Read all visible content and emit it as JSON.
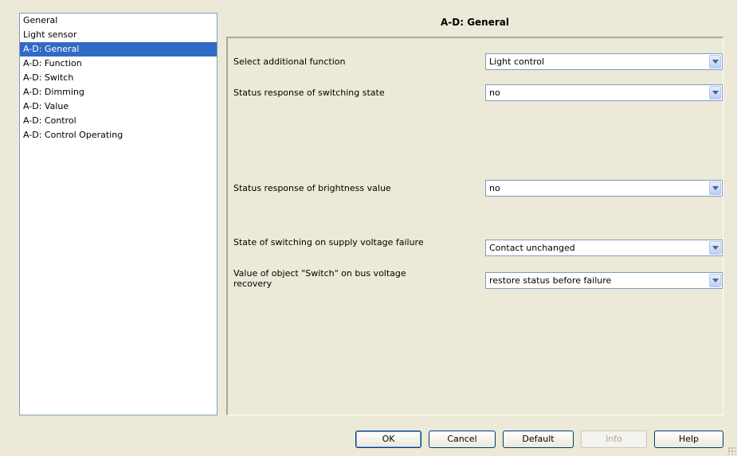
{
  "nav": {
    "items": [
      {
        "label": "General",
        "selected": false
      },
      {
        "label": "Light sensor",
        "selected": false
      },
      {
        "label": "A-D: General",
        "selected": true
      },
      {
        "label": "A-D: Function",
        "selected": false
      },
      {
        "label": "A-D: Switch",
        "selected": false
      },
      {
        "label": "A-D: Dimming",
        "selected": false
      },
      {
        "label": "A-D: Value",
        "selected": false
      },
      {
        "label": "A-D: Control",
        "selected": false
      },
      {
        "label": "A-D: Control Operating",
        "selected": false
      }
    ]
  },
  "page": {
    "title": "A-D: General"
  },
  "params": [
    {
      "label": "Select additional function",
      "value": "Light control"
    },
    {
      "label": "Status response of switching state",
      "value": "no"
    },
    {
      "label": "Status response of brightness value",
      "value": "no"
    },
    {
      "label": "State of switching on supply voltage failure",
      "value": "Contact unchanged"
    },
    {
      "label": "Value of object \"Switch\" on bus voltage recovery",
      "value": "restore status before failure"
    }
  ],
  "buttons": {
    "ok": "OK",
    "cancel": "Cancel",
    "default": "Default",
    "info": "Info",
    "help": "Help"
  },
  "colors": {
    "background": "#ece9d8",
    "selection": "#316ac5",
    "border": "#7f9db9"
  }
}
